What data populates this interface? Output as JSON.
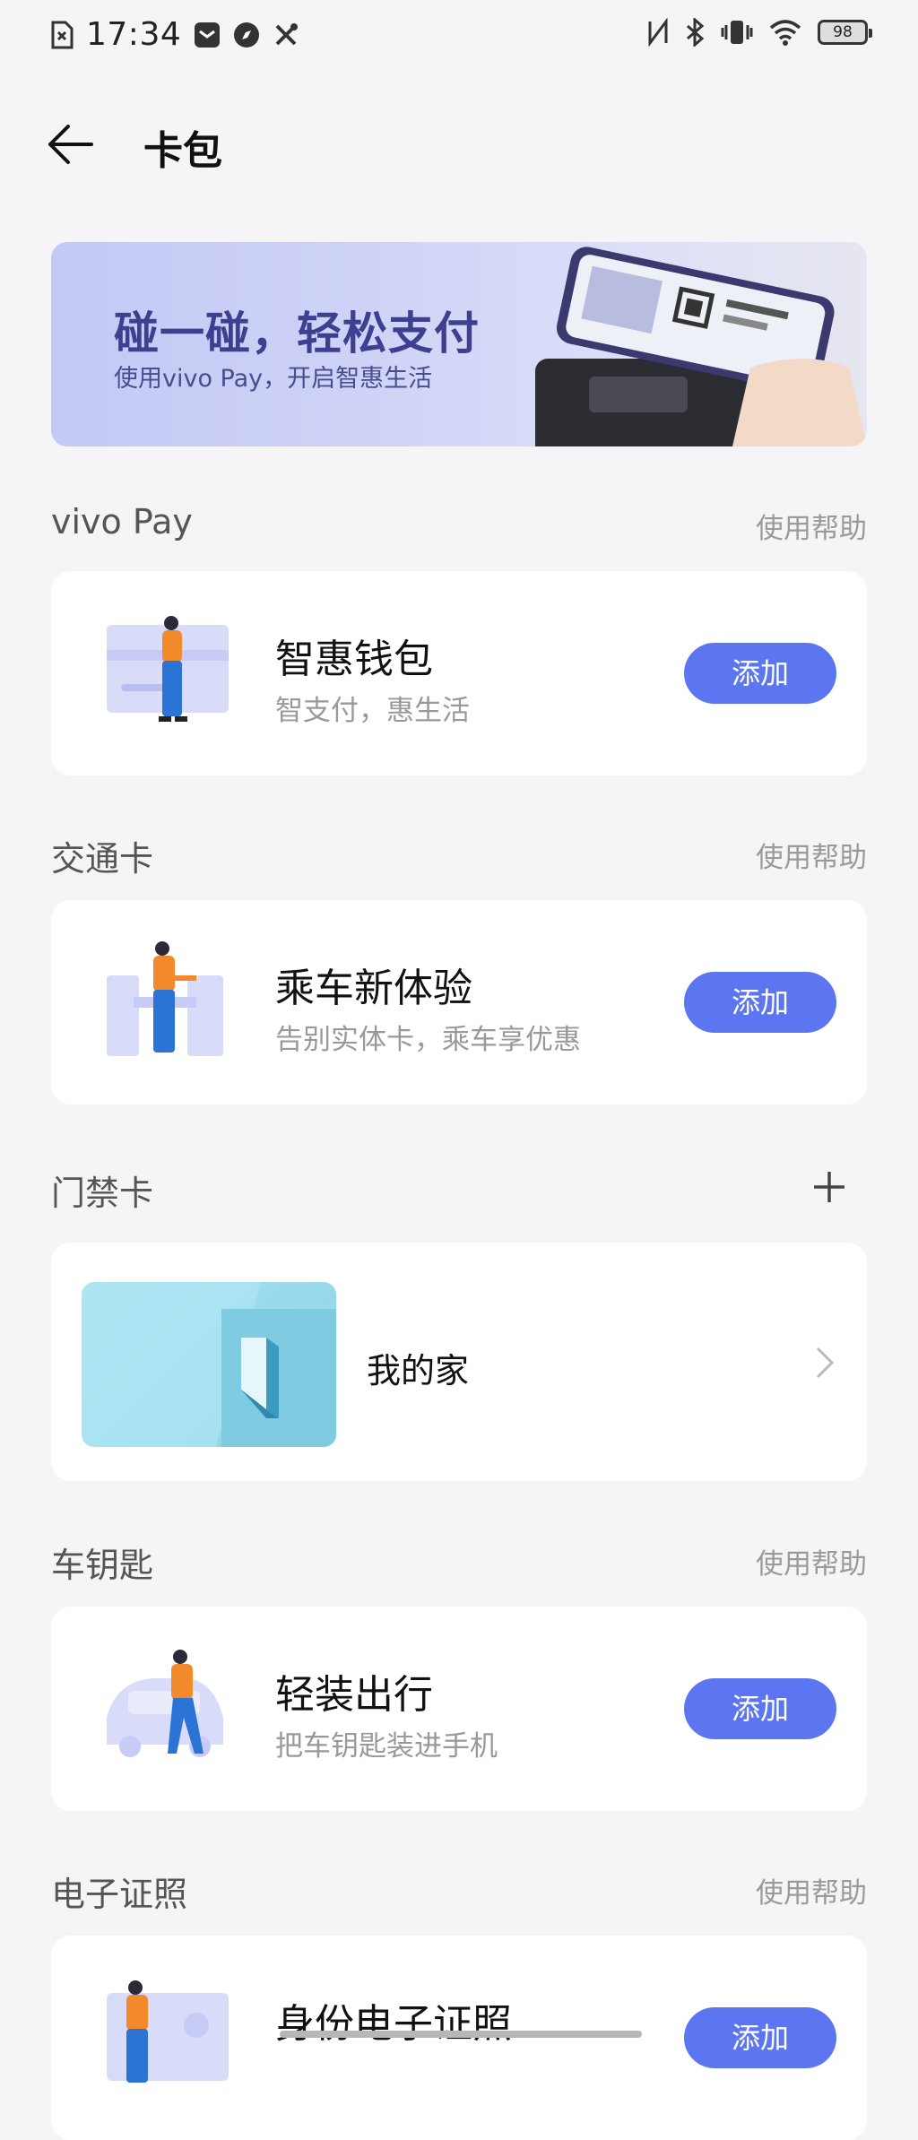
{
  "status_bar": {
    "time": "17:34",
    "battery": "98",
    "icons": [
      "sim-error-icon",
      "message-icon",
      "compass-icon",
      "tools-icon",
      "nfc-icon",
      "bluetooth-icon",
      "vibrate-icon",
      "wifi-icon",
      "battery-icon"
    ]
  },
  "header": {
    "title": "卡包"
  },
  "banner": {
    "title": "碰一碰，轻松支付",
    "subtitle": "使用vivo Pay，开启智惠生活"
  },
  "sections": {
    "vivopay": {
      "title": "vivo Pay",
      "help": "使用帮助",
      "card_name": "智惠钱包",
      "card_desc": "智支付，惠生活",
      "button": "添加"
    },
    "transit": {
      "title": "交通卡",
      "help": "使用帮助",
      "card_name": "乘车新体验",
      "card_desc": "告别实体卡，乘车享优惠",
      "button": "添加"
    },
    "access": {
      "title": "门禁卡",
      "card_name": "我的家"
    },
    "carkey": {
      "title": "车钥匙",
      "help": "使用帮助",
      "card_name": "轻装出行",
      "card_desc": "把车钥匙装进手机",
      "button": "添加"
    },
    "eid": {
      "title": "电子证照",
      "help": "使用帮助",
      "card_name": "身份电子证照",
      "button": "添加"
    }
  },
  "colors": {
    "accent": "#5b76f0",
    "background": "#f5f5f7"
  }
}
